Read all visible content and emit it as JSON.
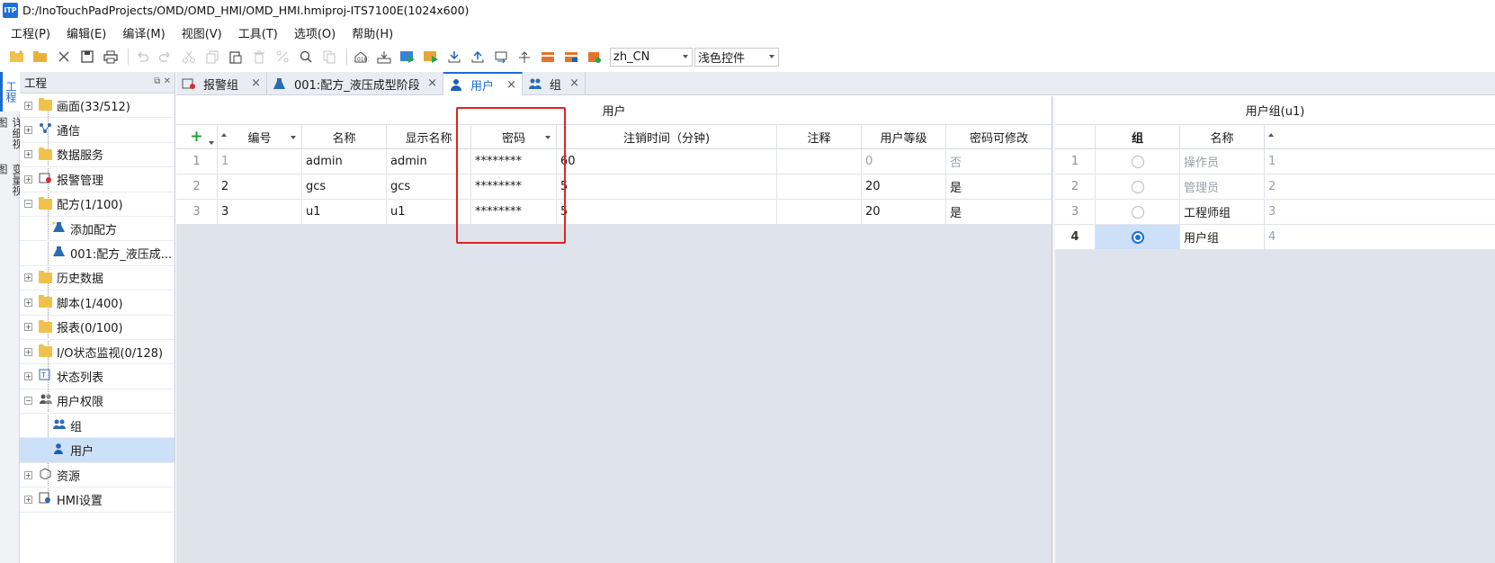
{
  "window": {
    "app_icon": "ITP",
    "title": "D:/InoTouchPadProjects/OMD/OMD_HMI/OMD_HMI.hmiproj-ITS7100E(1024x600)"
  },
  "menu": [
    "工程(P)",
    "编辑(E)",
    "编译(M)",
    "视图(V)",
    "工具(T)",
    "选项(O)",
    "帮助(H)"
  ],
  "toolbar": {
    "language": "zh_CN",
    "theme": "浅色控件"
  },
  "vstrip": {
    "tab_project": "工程",
    "tab_detail": "详细视图",
    "tab_variables": "变量视图"
  },
  "project_panel": {
    "title": "工程",
    "items": [
      {
        "label": "画面(33/512)",
        "icon": "screen-icon"
      },
      {
        "label": "通信",
        "icon": "network-icon"
      },
      {
        "label": "数据服务",
        "icon": "data-service-icon"
      },
      {
        "label": "报警管理",
        "icon": "alarm-icon"
      },
      {
        "label": "配方(1/100)",
        "icon": "recipe-icon"
      },
      {
        "label": "添加配方",
        "icon": "add-recipe-icon"
      },
      {
        "label": "001:配方_液压成...",
        "icon": "flask-icon"
      },
      {
        "label": "历史数据",
        "icon": "history-icon"
      },
      {
        "label": "脚本(1/400)",
        "icon": "script-icon"
      },
      {
        "label": "报表(0/100)",
        "icon": "report-icon"
      },
      {
        "label": "I/O状态监视(0/128)",
        "icon": "io-monitor-icon"
      },
      {
        "label": "状态列表",
        "icon": "status-list-icon"
      },
      {
        "label": "用户权限",
        "icon": "users-icon"
      },
      {
        "label": "组",
        "icon": "group-icon"
      },
      {
        "label": "用户",
        "icon": "user-icon"
      },
      {
        "label": "资源",
        "icon": "resource-icon"
      },
      {
        "label": "HMI设置",
        "icon": "settings-icon"
      }
    ]
  },
  "tabs": [
    {
      "label": "报警组",
      "icon": "alarm-group-icon"
    },
    {
      "label": "001:配方_液压成型阶段",
      "icon": "flask-icon"
    },
    {
      "label": "用户",
      "icon": "user-icon"
    },
    {
      "label": "组",
      "icon": "group-icon"
    }
  ],
  "users": {
    "title": "用户",
    "add": "+",
    "columns": [
      "编号",
      "名称",
      "显示名称",
      "密码",
      "注销时间（分钟)",
      "注释",
      "用户等级",
      "密码可修改"
    ],
    "rows": [
      {
        "num": "1",
        "id": "1",
        "name": "admin",
        "display": "admin",
        "password": "********",
        "logout": "60",
        "note": "",
        "level": "0",
        "changeable": "否"
      },
      {
        "num": "2",
        "id": "2",
        "name": "gcs",
        "display": "gcs",
        "password": "********",
        "logout": "5",
        "note": "",
        "level": "20",
        "changeable": "是"
      },
      {
        "num": "3",
        "id": "3",
        "name": "u1",
        "display": "u1",
        "password": "********",
        "logout": "5",
        "note": "",
        "level": "20",
        "changeable": "是"
      }
    ]
  },
  "groups": {
    "title": "用户组(u1)",
    "columns": [
      "组",
      "名称"
    ],
    "rows": [
      {
        "num": "1",
        "name": "操作员",
        "id": "1",
        "selected": false
      },
      {
        "num": "2",
        "name": "管理员",
        "id": "2",
        "selected": false
      },
      {
        "num": "3",
        "name": "工程师组",
        "id": "3",
        "selected": false
      },
      {
        "num": "4",
        "name": "用户组",
        "id": "4",
        "selected": true
      }
    ]
  }
}
